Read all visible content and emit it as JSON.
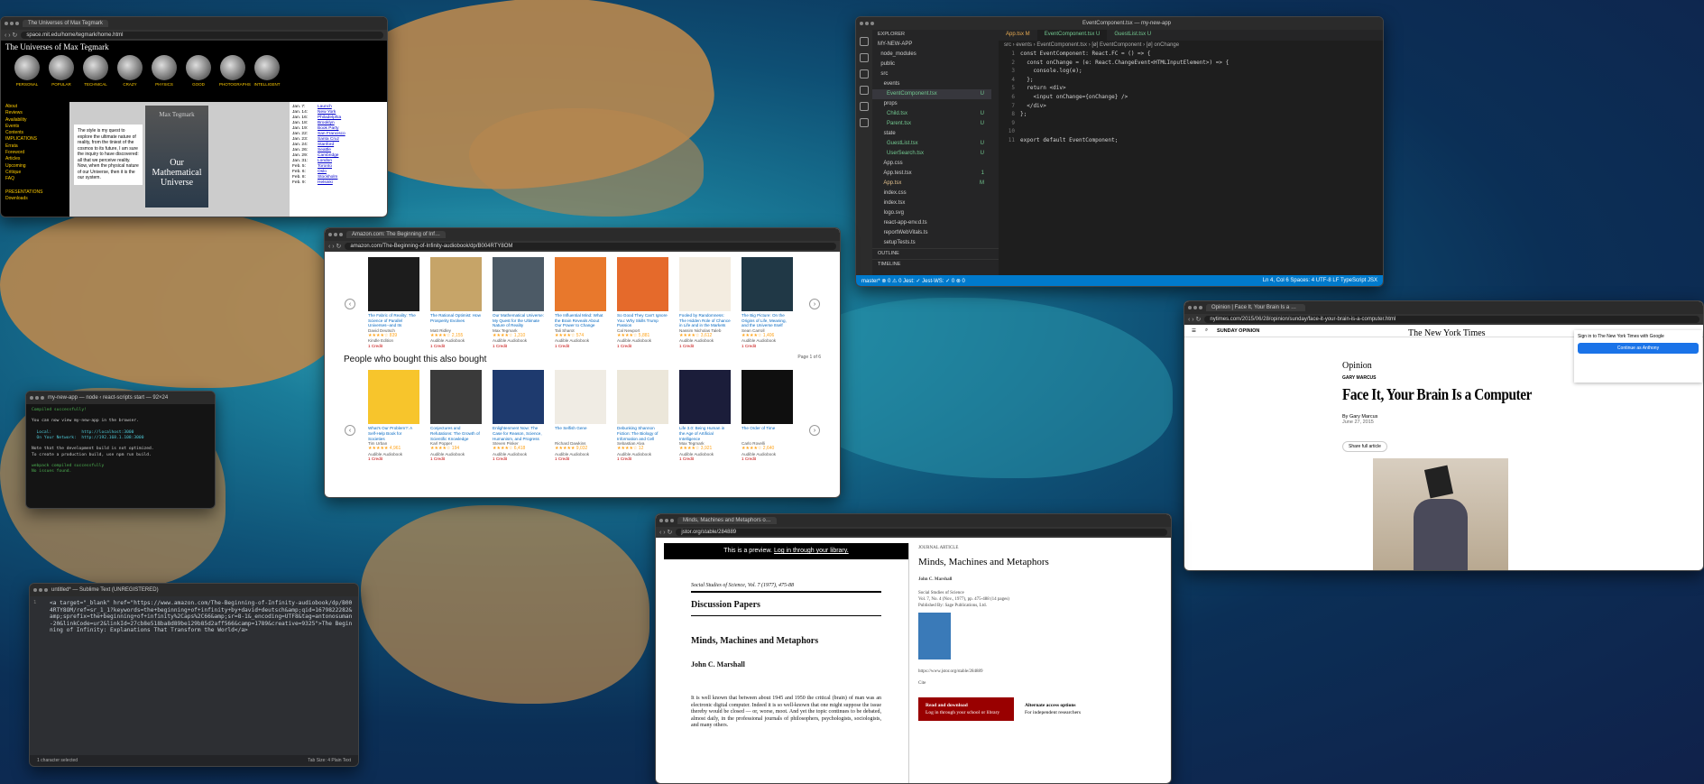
{
  "tegmark": {
    "tab": "The Universes of Max Tegmark",
    "url": "space.mit.edu/home/tegmark/home.html",
    "title": "The Universes of Max Tegmark",
    "icons": [
      "PERSONAL",
      "POPULAR",
      "TECHNICAL",
      "CRAZY",
      "PHYSICS",
      "GOOD",
      "PHOTOGRAPHS",
      "INTELLIGENT"
    ],
    "sidebar": [
      "About",
      "Reviews",
      "Availability",
      "Events",
      "Contents",
      "IMPLICATIONS",
      "Errata",
      "Foreword",
      "Articles",
      "Upcoming",
      "Critique",
      "FAQ",
      "",
      "PRESENTATIONS",
      "Downloads"
    ],
    "intro": "The style is my quest to explore the ultimate nature of reality, from the tiniest of the cosmos to its future, I am sure the inquiry to have discovered: all that we perceive reality. Now, when the physical nature of our Universe, then it is the our system.",
    "book_author": "Max Tegmark",
    "book_title": "Our Mathematical Universe",
    "events": [
      [
        "Jan. 7:",
        "Launch"
      ],
      [
        "Jan. 14:",
        "New York"
      ],
      [
        "Jan. 16:",
        "Philadelphia"
      ],
      [
        "Jan. 18:",
        "Brooklyn"
      ],
      [
        "Jan. 19:",
        "Book Party"
      ],
      [
        "Jan. 22:",
        "San Francisco"
      ],
      [
        "Jan. 23:",
        "Santa Cruz"
      ],
      [
        "Jan. 24:",
        "Stanford"
      ],
      [
        "Jan. 26:",
        "Seattle"
      ],
      [
        "Jan. 29:",
        "Cambridge"
      ],
      [
        "Jan. 31:",
        "London"
      ],
      [
        "Feb. 5:",
        "Toronto"
      ],
      [
        "Feb. 6:",
        "Oslo"
      ],
      [
        "Feb. 8:",
        "Stockholm"
      ],
      [
        "Feb. 9:",
        "Helsinki"
      ]
    ]
  },
  "vscode": {
    "title": "EventComponent.tsx — my-new-app",
    "explorer": "EXPLORER",
    "files": [
      [
        "MY-NEW-APP",
        ""
      ],
      [
        "  node_modules",
        ""
      ],
      [
        "  public",
        ""
      ],
      [
        "  src",
        ""
      ],
      [
        "    events",
        ""
      ],
      [
        "      EventComponent.tsx",
        "U"
      ],
      [
        "    props",
        ""
      ],
      [
        "      Child.tsx",
        "U"
      ],
      [
        "      Parent.tsx",
        "U"
      ],
      [
        "    state",
        ""
      ],
      [
        "      GuestList.tsx",
        "U"
      ],
      [
        "      UserSearch.tsx",
        "U"
      ],
      [
        "    App.css",
        ""
      ],
      [
        "    App.test.tsx",
        "1"
      ],
      [
        "    App.tsx",
        "M"
      ],
      [
        "    index.css",
        ""
      ],
      [
        "    index.tsx",
        ""
      ],
      [
        "    logo.svg",
        ""
      ],
      [
        "    react-app-env.d.ts",
        ""
      ],
      [
        "    reportWebVitals.ts",
        ""
      ],
      [
        "    setupTests.ts",
        ""
      ]
    ],
    "outline": "OUTLINE",
    "timeline": "TIMELINE",
    "tabs": [
      "App.tsx M",
      "EventComponent.tsx U",
      "GuestList.tsx U"
    ],
    "breadcrumb": "src › events › EventComponent.tsx › [ø] EventComponent › [ø] onChange",
    "code": [
      "const EventComponent: React.FC = () => {",
      "  const onChange = (e: React.ChangeEvent<HTMLInputElement>) => {",
      "    console.log(e);",
      "  };",
      "  return <div>",
      "    <input onChange={onChange} />",
      "  </div>",
      "};",
      "",
      "",
      "export default EventComponent;"
    ],
    "status_left": "master*  ⊗ 0 ⚠ 0  Jest: ✓  Jest-WS: ✓ 0 ⊗ 0",
    "status_right": "Ln 4, Col 6   Spaces: 4   UTF-8   LF   TypeScript JSX"
  },
  "amazon": {
    "tab": "Amazon.com: The Beginning of Infinity",
    "url": "amazon.com/The-Beginning-of-Infinity-audiobook/dp/B004RTY8OM",
    "row1": [
      {
        "title": "The Fabric of Reality: The Science of Parallel Universes--and Its Implications",
        "author": "David Deutsch",
        "stars": "★★★★☆ 839",
        "fmt": "Kindle Edition",
        "color": "#1c1c1c"
      },
      {
        "title": "The Rational Optimist: How Prosperity Evolves",
        "author": "Matt Ridley",
        "stars": "★★★★☆ 2,155",
        "fmt": "Audible Audiobook",
        "color": "#c6a468"
      },
      {
        "title": "Our Mathematical Universe: My Quest for the Ultimate Nature of Reality",
        "author": "Max Tegmark",
        "stars": "★★★★☆ 1,310",
        "fmt": "Audible Audiobook",
        "color": "#4c5a66"
      },
      {
        "title": "The Influential Mind: What the Brain Reveals About Our Power to Change Others",
        "author": "Tali Sharot",
        "stars": "★★★★☆ 574",
        "fmt": "Audible Audiobook",
        "color": "#e8782c"
      },
      {
        "title": "So Good They Can't Ignore You: Why Skills Trump Passion",
        "author": "Cal Newport",
        "stars": "★★★★☆ 5,881",
        "fmt": "Audible Audiobook",
        "color": "#e56a2b"
      },
      {
        "title": "Fooled by Randomness: The Hidden Role of Chance in Life and in the Markets",
        "author": "Nassim Nicholas Taleb",
        "stars": "★★★★☆ 3,612",
        "fmt": "Audible Audiobook",
        "color": "#f3ece0"
      },
      {
        "title": "The Big Picture: On the Origins of Life, Meaning, and the Universe Itself",
        "author": "Sean Carroll",
        "stars": "★★★★☆ 1,406",
        "fmt": "Audible Audiobook",
        "color": "#203846"
      }
    ],
    "heading2": "People who bought this also bought",
    "page": "Page 1 of 6",
    "row2": [
      {
        "title": "What's Our Problem?: A Self-Help Book for Societies",
        "author": "Tim Urban",
        "stars": "★★★★★ 4,961",
        "fmt": "Audible Audiobook",
        "color": "#f7c52c"
      },
      {
        "title": "Conjectures and Refutations: The Growth of Scientific Knowledge",
        "author": "Karl Popper",
        "stars": "★★★★☆ 194",
        "fmt": "Audible Audiobook",
        "color": "#3a3a3a"
      },
      {
        "title": "Enlightenment Now: The Case for Reason, Science, Humanism, and Progress",
        "author": "Steven Pinker",
        "stars": "★★★★☆ 6,418",
        "fmt": "Audible Audiobook",
        "color": "#1e3a6e"
      },
      {
        "title": "The Selfish Gene",
        "author": "Richard Dawkins",
        "stars": "★★★★★ 9,032",
        "fmt": "Audible Audiobook",
        "color": "#f0ece4"
      },
      {
        "title": "Debunking Shannon Fiction: The Biology of Information and Cell Memory",
        "author": "Sebastian Alva",
        "stars": "★★★★☆ 12",
        "fmt": "Audible Audiobook",
        "color": "#ece7da"
      },
      {
        "title": "Life 3.0: Being Human in the Age of Artificial Intelligence",
        "author": "Max Tegmark",
        "stars": "★★★★☆ 3,921",
        "fmt": "Audible Audiobook",
        "color": "#1b1d3a"
      },
      {
        "title": "The Order of Time",
        "author": "Carlo Rovelli",
        "stars": "★★★★☆ 2,640",
        "fmt": "Audible Audiobook",
        "color": "#0f0f0f"
      }
    ],
    "credits": "1 Credit"
  },
  "nyt": {
    "tab": "Opinion | Face It, Your Brain Is a Computer",
    "url": "nytimes.com/2015/06/28/opinion/sunday/face-it-your-brain-is-a-computer.html",
    "section": "SUNDAY OPINION",
    "logo": "The New York Times",
    "opinion": "Opinion",
    "kicker": "GARY MARCUS",
    "headline": "Face It, Your Brain Is a Computer",
    "byline": "By Gary Marcus",
    "date": "June 27, 2015",
    "share": "Share full article",
    "google": "Sign in to The New York Times with Google",
    "google_btn": "Continue as Anthony"
  },
  "terminal": {
    "title": "my-new-app — node ‹ react-scripts start — 92×24",
    "lines": [
      "Compiled successfully!",
      "",
      "You can now view my-new-app in the browser.",
      "",
      "  Local:            http://localhost:3000",
      "  On Your Network:  http://192.168.1.108:3000",
      "",
      "Note that the development build is not optimized.",
      "To create a production build, use npm run build.",
      "",
      "webpack compiled successfully",
      "No issues found."
    ]
  },
  "editor": {
    "title": "untitled* — Sublime Text (UNREGISTERED)",
    "text": "<a target=\"_blank\" href=\"https://www.amazon.com/The-Beginning-of-Infinity-audiobook/dp/B004RTY8OM/ref=sr_1_1?keywords=the+beginning+of+infinity+by+david+deutsch&amp;qid=1679822282&amp;sprefix=the+beginning+of+infinity%2Caps%2C66&amp;sr=8-1&_encoding=UTF8&tag=antonosuman-20&linkCode=ur2&linkId=27cb8e518ba8d89be129b85d2aff566&camp=1789&creative=9325\">The Beginning of Infinity: Explanations That Transform the World</a>",
    "status_left": "1 character selected",
    "status_right": "Tab Size: 4    Plain Text"
  },
  "jstor": {
    "tab": "Minds, Machines and Metaphors on JSTOR",
    "url": "jstor.org/stable/284889",
    "preview_pre": "This is a preview.",
    "preview_link": "Log in through your library.",
    "journal": "Social Studies of Science, Vol. 7 (1977), 475-88",
    "section": "Discussion Papers",
    "title": "Minds, Machines and Metaphors",
    "author": "John C. Marshall",
    "body": "It is well known that between about 1945 and 1950 the critical (brain) of man was an electronic digital computer. Indeed it is so well-known that one might suppose the issue thereby would be closed — or, worse, moot. And yet the topic continues to be debated, almost daily, in the professional journals of philosophers, psychologists, sociologists, and many others.",
    "r_journal": "JOURNAL ARTICLE",
    "r_title": "Minds, Machines and Metaphors",
    "r_author": "John C. Marshall",
    "r_source": "Social Studies of Science",
    "r_vol": "Vol. 7, No. 4 (Nov., 1977), pp. 475-488 (14 pages)",
    "r_pub": "Published By: Sage Publications, Ltd.",
    "r_doi": "https://www.jstor.org/stable/284889",
    "r_cite": "Cite",
    "btn_read": "Read and download",
    "btn_read_sub": "Log in through your school or library",
    "btn_alt": "Alternate access options",
    "btn_alt_sub": "For independent researchers"
  }
}
